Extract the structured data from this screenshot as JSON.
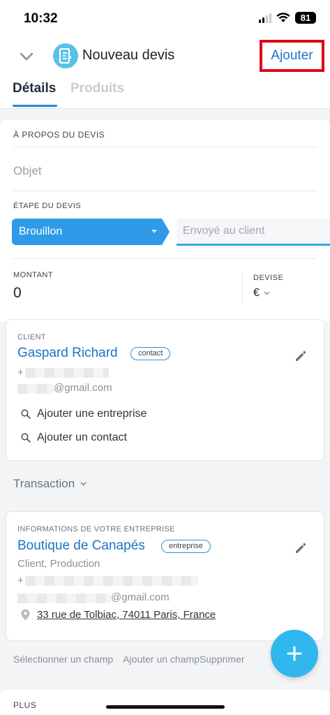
{
  "status_bar": {
    "time": "10:32",
    "battery": "81"
  },
  "header": {
    "title": "Nouveau devis",
    "add_label": "Ajouter",
    "tabs": [
      {
        "label": "Détails",
        "active": true
      },
      {
        "label": "Produits",
        "active": false
      }
    ]
  },
  "about": {
    "section_title": "À PROPOS DU DEVIS",
    "subject_placeholder": "Objet",
    "stage_label": "ÉTAPE DU DEVIS",
    "stage_current": "Brouillon",
    "stage_next": "Envoyé au client",
    "amount_label": "MONTANT",
    "amount_value": "0",
    "currency_label": "DEVISE",
    "currency_value": "€"
  },
  "client": {
    "label": "CLIENT",
    "name": "Gaspard Richard",
    "tag": "contact",
    "phone_prefix": "+",
    "email_suffix": "@gmail.com",
    "actions": [
      "Ajouter une entreprise",
      "Ajouter un contact"
    ]
  },
  "transaction": {
    "label": "Transaction"
  },
  "company": {
    "label": "INFORMATIONS DE VOTRE ENTREPRISE",
    "name": "Boutique de Canapés",
    "tag": "entreprise",
    "roles": "Client, Production",
    "phone_prefix": "+",
    "email_suffix": "@gmail.com",
    "address": "33 rue de Tolbiac, 74011 Paris, France"
  },
  "footer_links": [
    "Sélectionner un champ",
    "Ajouter un champ",
    "Supprimer"
  ],
  "more": {
    "label": "PLUS"
  },
  "colors": {
    "accent": "#1c73c9",
    "stage": "#2f9be8",
    "fab": "#2fb7ee",
    "highlight": "#e0001a"
  }
}
